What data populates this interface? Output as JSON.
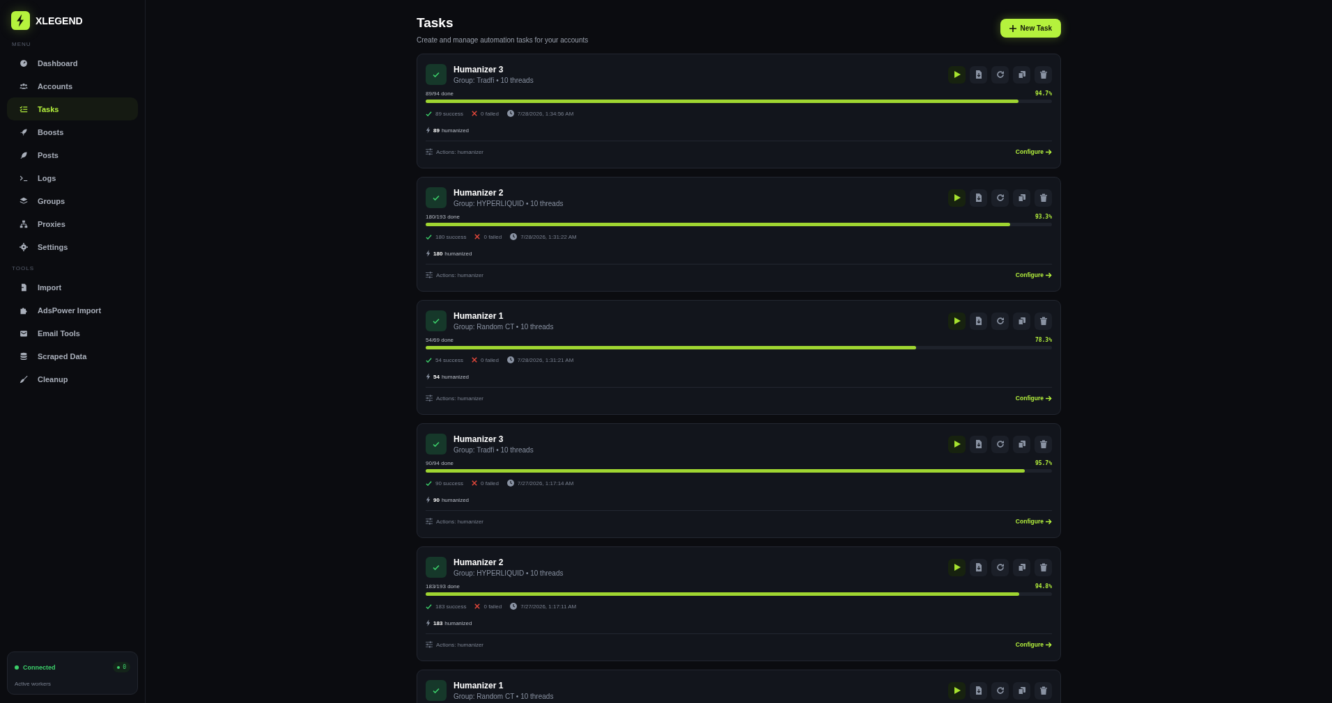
{
  "brand": {
    "name": "XLEGEND"
  },
  "sidebar": {
    "sections": [
      {
        "label": "MENU",
        "items": [
          {
            "label": "Dashboard",
            "selected": false
          },
          {
            "label": "Accounts",
            "selected": false
          },
          {
            "label": "Tasks",
            "selected": true
          },
          {
            "label": "Boosts",
            "selected": false
          },
          {
            "label": "Posts",
            "selected": false
          },
          {
            "label": "Logs",
            "selected": false
          },
          {
            "label": "Groups",
            "selected": false
          },
          {
            "label": "Proxies",
            "selected": false
          },
          {
            "label": "Settings",
            "selected": false
          }
        ]
      },
      {
        "label": "TOOLS",
        "items": [
          {
            "label": "Import",
            "selected": false
          },
          {
            "label": "AdsPower Import",
            "selected": false
          },
          {
            "label": "Email Tools",
            "selected": false
          },
          {
            "label": "Scraped Data",
            "selected": false
          },
          {
            "label": "Cleanup",
            "selected": false
          }
        ]
      }
    ]
  },
  "status": {
    "label": "Connected",
    "count": "0",
    "caption": "Active workers"
  },
  "page": {
    "title": "Tasks",
    "subtitle": "Create and manage automation tasks for your accounts",
    "new_button": "New Task"
  },
  "tasks": [
    {
      "name": "Humanizer 3",
      "meta": "Group: Tradfi • 10 threads",
      "progress": "89/94 done",
      "percent": "94.7%",
      "level": 0.947,
      "success": "89 success",
      "failed": "0 failed",
      "time": "7/28/2026, 1:34:56 AM",
      "count": "89",
      "count_label": "humanized",
      "actions": "Actions: humanizer",
      "configure": "Configure"
    },
    {
      "name": "Humanizer 2",
      "meta": "Group: HYPERLIQUID • 10 threads",
      "progress": "180/193 done",
      "percent": "93.3%",
      "level": 0.933,
      "success": "180 success",
      "failed": "0 failed",
      "time": "7/28/2026, 1:31:22 AM",
      "count": "180",
      "count_label": "humanized",
      "actions": "Actions: humanizer",
      "configure": "Configure"
    },
    {
      "name": "Humanizer 1",
      "meta": "Group: Random CT • 10 threads",
      "progress": "54/69 done",
      "percent": "78.3%",
      "level": 0.783,
      "success": "54 success",
      "failed": "0 failed",
      "time": "7/28/2026, 1:31:21 AM",
      "count": "54",
      "count_label": "humanized",
      "actions": "Actions: humanizer",
      "configure": "Configure"
    },
    {
      "name": "Humanizer 3",
      "meta": "Group: Tradfi • 10 threads",
      "progress": "90/94 done",
      "percent": "95.7%",
      "level": 0.957,
      "success": "90 success",
      "failed": "0 failed",
      "time": "7/27/2026, 1:17:14 AM",
      "count": "90",
      "count_label": "humanized",
      "actions": "Actions: humanizer",
      "configure": "Configure"
    },
    {
      "name": "Humanizer 2",
      "meta": "Group: HYPERLIQUID • 10 threads",
      "progress": "183/193 done",
      "percent": "94.8%",
      "level": 0.948,
      "success": "183 success",
      "failed": "0 failed",
      "time": "7/27/2026, 1:17:11 AM",
      "count": "183",
      "count_label": "humanized",
      "actions": "Actions: humanizer",
      "configure": "Configure"
    },
    {
      "name": "Humanizer 1",
      "meta": "Group: Random CT • 10 threads"
    }
  ]
}
